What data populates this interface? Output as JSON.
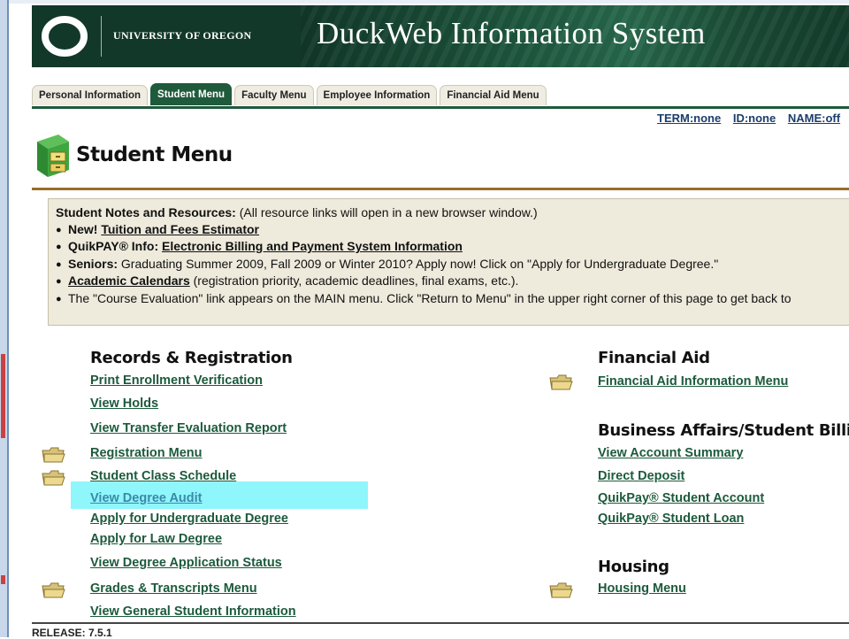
{
  "banner": {
    "logo_letter": "O",
    "university_name": "UNIVERSITY OF OREGON",
    "system_title": "DuckWeb Information System"
  },
  "tabs": [
    {
      "label": "Personal Information",
      "active": false
    },
    {
      "label": "Student Menu",
      "active": true
    },
    {
      "label": "Faculty Menu",
      "active": false
    },
    {
      "label": "Employee Information",
      "active": false
    },
    {
      "label": "Financial Aid Menu",
      "active": false
    }
  ],
  "infobar": {
    "term": "TERM:none",
    "id": "ID:none",
    "name": "NAME:off"
  },
  "page": {
    "title": "Student Menu",
    "icon": "file-cabinet-icon"
  },
  "notes": {
    "heading": "Student Notes and Resources:",
    "heading_note": " (All resource links will open in a new browser window.)",
    "items": [
      {
        "prefix": "New! ",
        "link": "Tuition and Fees Estimator",
        "suffix": ""
      },
      {
        "prefix": "QuikPAY® Info: ",
        "link": "Electronic Billing and Payment System Information",
        "suffix": ""
      },
      {
        "prefix_bold": "Seniors:",
        "text": " Graduating Summer 2009, Fall 2009 or Winter 2010? Apply now! Click on \"Apply for Undergraduate Degree.\""
      },
      {
        "prefix": "",
        "link": "Academic Calendars",
        "suffix": " (registration priority, academic deadlines, final exams, etc.)."
      },
      {
        "text": "The \"Course Evaluation\" link appears on the MAIN menu. Click \"Return to Menu\" in the upper right corner of this page to get back to"
      }
    ]
  },
  "records": {
    "title": "Records & Registration",
    "links": [
      "Print Enrollment Verification",
      "View Holds",
      "View Transfer Evaluation Report",
      "Registration Menu",
      "Student Class Schedule",
      "View Degree Audit",
      "Apply for Undergraduate Degree",
      "Apply for Law Degree",
      "View Degree Application Status",
      "Grades & Transcripts Menu",
      "View General Student Information"
    ]
  },
  "financial_aid": {
    "title": "Financial Aid",
    "links": [
      "Financial Aid Information Menu"
    ]
  },
  "business": {
    "title": "Business Affairs/Student Billing",
    "links": [
      "View Account Summary",
      "Direct Deposit",
      "QuikPay® Student Account",
      "QuikPay® Student Loan"
    ]
  },
  "housing": {
    "title": "Housing",
    "links": [
      "Housing Menu"
    ]
  },
  "footer": {
    "release": "RELEASE: 7.5.1"
  },
  "colors": {
    "banner_green": "#12382a",
    "link_green": "#1c5a3c",
    "highlight": "#8ff6fb",
    "rule_brown": "#9a6d2c"
  }
}
